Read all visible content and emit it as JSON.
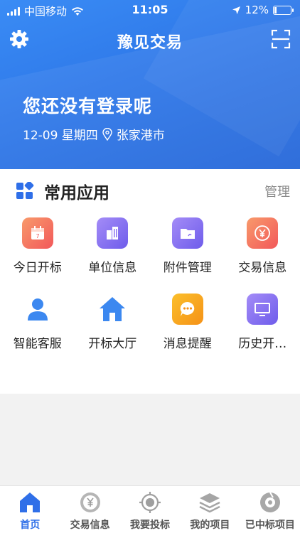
{
  "status_bar": {
    "carrier": "中国移动",
    "time": "11:05",
    "battery": "12%",
    "battery_level": 0.12
  },
  "header": {
    "title": "豫见交易",
    "icons": [
      "gear-icon",
      "scan-icon"
    ]
  },
  "hero": {
    "greeting": "您还没有登录呢",
    "date": "12-09 星期四",
    "location": "张家港市"
  },
  "section": {
    "title": "常用应用",
    "manage_label": "管理"
  },
  "apps": [
    {
      "label": "今日开标",
      "icon": "calendar-icon",
      "color": "#f47a63"
    },
    {
      "label": "单位信息",
      "icon": "building-icon",
      "color": "#8a74f2"
    },
    {
      "label": "附件管理",
      "icon": "folder-icon",
      "color": "#8a74f2"
    },
    {
      "label": "交易信息",
      "icon": "yuan-icon",
      "color": "#f47a63"
    },
    {
      "label": "智能客服",
      "icon": "person-icon",
      "color": "#3c88f0"
    },
    {
      "label": "开标大厅",
      "icon": "house-icon",
      "color": "#3c88f0"
    },
    {
      "label": "消息提醒",
      "icon": "message-icon",
      "color": "#f7a520"
    },
    {
      "label": "历史开…",
      "icon": "monitor-icon",
      "color": "#8a74f2"
    }
  ],
  "tabs": [
    {
      "label": "首页",
      "icon": "home-icon",
      "active": true
    },
    {
      "label": "交易信息",
      "icon": "yuan-circle-icon",
      "active": false
    },
    {
      "label": "我要投标",
      "icon": "target-icon",
      "active": false
    },
    {
      "label": "我的项目",
      "icon": "layers-icon",
      "active": false
    },
    {
      "label": "已中标项目",
      "icon": "award-icon",
      "active": false
    }
  ],
  "colors": {
    "primary": "#2f6fe8",
    "hero_blue": "#2c74e6"
  }
}
